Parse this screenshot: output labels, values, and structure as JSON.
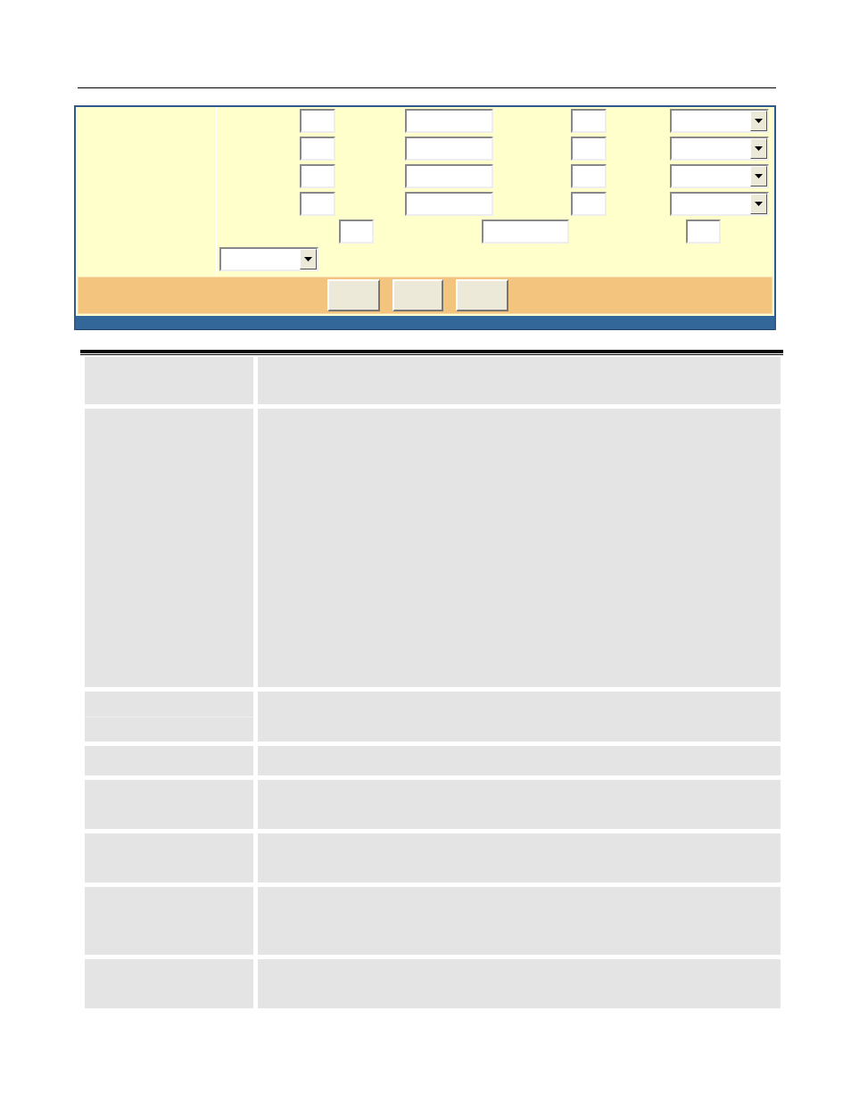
{
  "form": {
    "rows": [
      {
        "fields": [
          {
            "kind": "text"
          },
          {
            "kind": "text"
          },
          {
            "kind": "text"
          },
          {
            "kind": "select"
          }
        ]
      },
      {
        "fields": [
          {
            "kind": "text"
          },
          {
            "kind": "text"
          },
          {
            "kind": "text"
          },
          {
            "kind": "select"
          }
        ]
      },
      {
        "fields": [
          {
            "kind": "text"
          },
          {
            "kind": "text"
          },
          {
            "kind": "text"
          },
          {
            "kind": "select"
          }
        ]
      },
      {
        "fields": [
          {
            "kind": "text"
          },
          {
            "kind": "text"
          },
          {
            "kind": "text"
          },
          {
            "kind": "select"
          }
        ]
      },
      {
        "fields": [
          {
            "kind": "text"
          },
          {
            "kind": "text"
          },
          {
            "kind": "text"
          }
        ]
      },
      {
        "fields": [
          {
            "kind": "select"
          }
        ]
      }
    ],
    "buttons": [
      {
        "kind": "button"
      },
      {
        "kind": "button"
      },
      {
        "kind": "button"
      }
    ]
  },
  "table": {
    "rows": [
      {
        "kind": "row"
      },
      {
        "kind": "row"
      },
      {
        "kind": "split"
      },
      {
        "kind": "row"
      },
      {
        "kind": "row"
      },
      {
        "kind": "row"
      },
      {
        "kind": "row"
      },
      {
        "kind": "row"
      }
    ]
  }
}
